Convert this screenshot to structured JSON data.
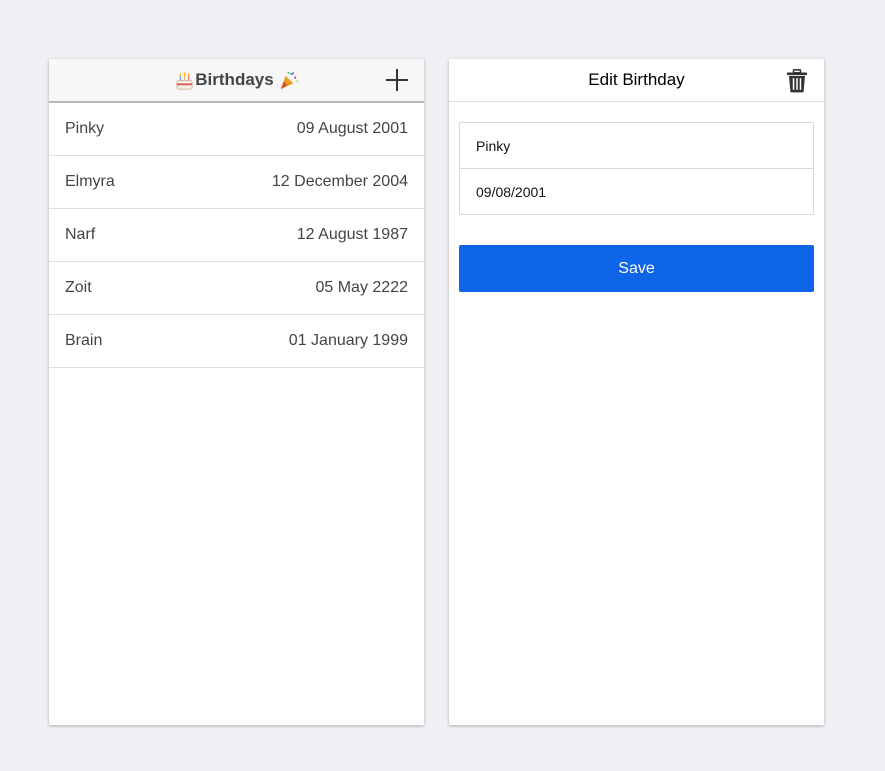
{
  "list_panel": {
    "title": "Birthdays",
    "title_prefix_icon": "birthday-cake-icon",
    "title_suffix_icon": "party-popper-icon",
    "add_icon": "plus-icon",
    "birthdays": [
      {
        "name": "Pinky",
        "date": "09 August 2001"
      },
      {
        "name": "Elmyra",
        "date": "12 December 2004"
      },
      {
        "name": "Narf",
        "date": "12 August 1987"
      },
      {
        "name": "Zoit",
        "date": "05 May 2222"
      },
      {
        "name": "Brain",
        "date": "01 January 1999"
      }
    ]
  },
  "edit_panel": {
    "title": "Edit Birthday",
    "delete_icon": "trash-icon",
    "name_value": "Pinky",
    "date_value": "09/08/2001",
    "save_label": "Save"
  },
  "colors": {
    "background": "#eff0f4",
    "accent": "#0f65e8"
  }
}
